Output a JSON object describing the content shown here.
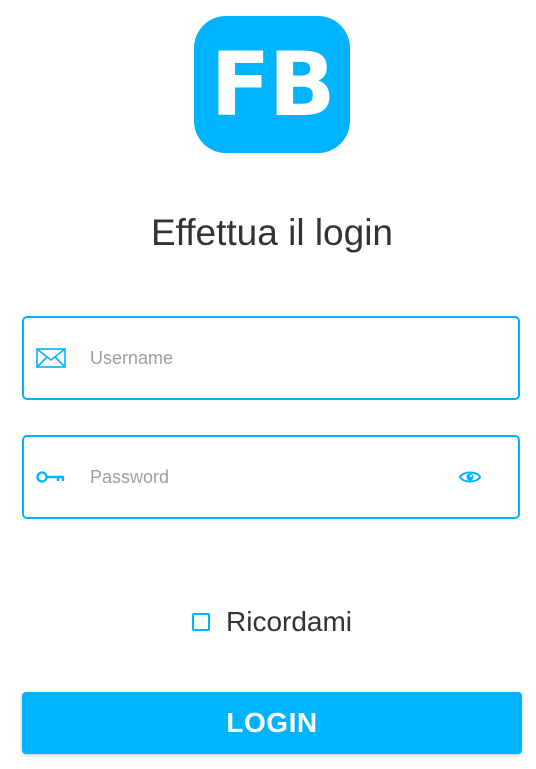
{
  "logo": {
    "text": "FB",
    "color": "#00b3ff"
  },
  "title": "Effettua il login",
  "username": {
    "placeholder": "Username",
    "value": "",
    "icon": "mail-icon"
  },
  "password": {
    "placeholder": "Password",
    "value": "",
    "icon": "key-icon",
    "toggle_icon": "eye-icon"
  },
  "remember": {
    "label": "Ricordami",
    "checked": false
  },
  "login_button": {
    "label": "LOGIN"
  },
  "colors": {
    "accent": "#00b3ff",
    "text": "#333333",
    "placeholder": "#9e9e9e"
  }
}
